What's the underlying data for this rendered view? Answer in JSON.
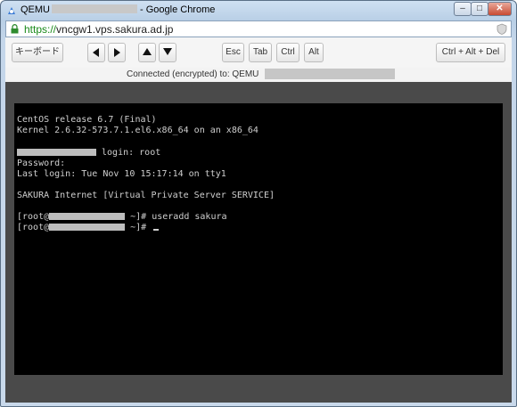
{
  "window": {
    "title_prefix": "QEMU",
    "title_suffix": "- Google Chrome",
    "min_label": "–",
    "max_label": "□",
    "close_label": "✕"
  },
  "address": {
    "scheme": "https://",
    "rest": "vncgw1.vps.sakura.ad.jp"
  },
  "toolbar": {
    "keyboard_label": "キーボード",
    "esc_label": "Esc",
    "tab_label": "Tab",
    "ctrl_label": "Ctrl",
    "alt_label": "Alt",
    "cad_label": "Ctrl + Alt + Del"
  },
  "status": {
    "text": "Connected (encrypted) to: QEMU"
  },
  "terminal": {
    "line1": "CentOS release 6.7 (Final)",
    "line2": "Kernel 2.6.32-573.7.1.el6.x86_64 on an x86_64",
    "login_suffix": " login: root",
    "password": "Password:",
    "last_login": "Last login: Tue Nov 10 15:17:14 on tty1",
    "banner": "SAKURA Internet [Virtual Private Server SERVICE]",
    "prompt_open": "[root@",
    "cmd1_tail": " ~]# useradd sakura",
    "cmd2_tail": " ~]# "
  },
  "colors": {
    "window_frame": "#c4d6ea",
    "terminal_bg": "#000000",
    "terminal_fg": "#cfcfcf",
    "stage_bg": "#4a4a4a"
  }
}
